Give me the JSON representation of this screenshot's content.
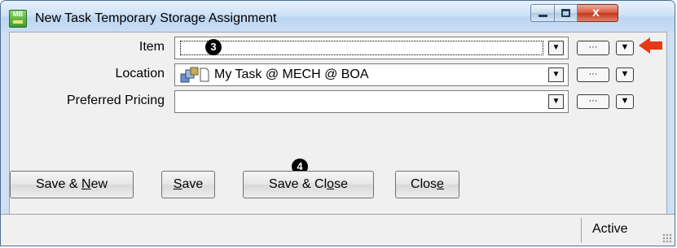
{
  "window": {
    "title": "New Task Temporary Storage Assignment",
    "app_icon_text": "MB"
  },
  "form": {
    "item": {
      "label": "Item",
      "value": ""
    },
    "location": {
      "label": "Location",
      "value": "My Task @ MECH @ BOA"
    },
    "preferred_pricing": {
      "label": "Preferred Pricing",
      "value": ""
    },
    "lookup_glyph": "···",
    "dropdown_glyph": "▼"
  },
  "callouts": {
    "item": "3",
    "buttons": "4"
  },
  "buttons": {
    "save_new": {
      "pre": "Save & ",
      "accel": "N",
      "post": "ew"
    },
    "save": {
      "pre": "",
      "accel": "S",
      "post": "ave"
    },
    "save_close": {
      "pre": "Save & Cl",
      "accel": "o",
      "post": "se"
    },
    "close": {
      "pre": "Clos",
      "accel": "e",
      "post": ""
    }
  },
  "status": {
    "text": "Active"
  },
  "colors": {
    "pointer_arrow": "#e53a14",
    "close_button": "#c2371b"
  },
  "icons": [
    "app-icon",
    "minimize-icon",
    "maximize-icon",
    "close-icon",
    "location-icon",
    "red-pointer-arrow-icon"
  ]
}
